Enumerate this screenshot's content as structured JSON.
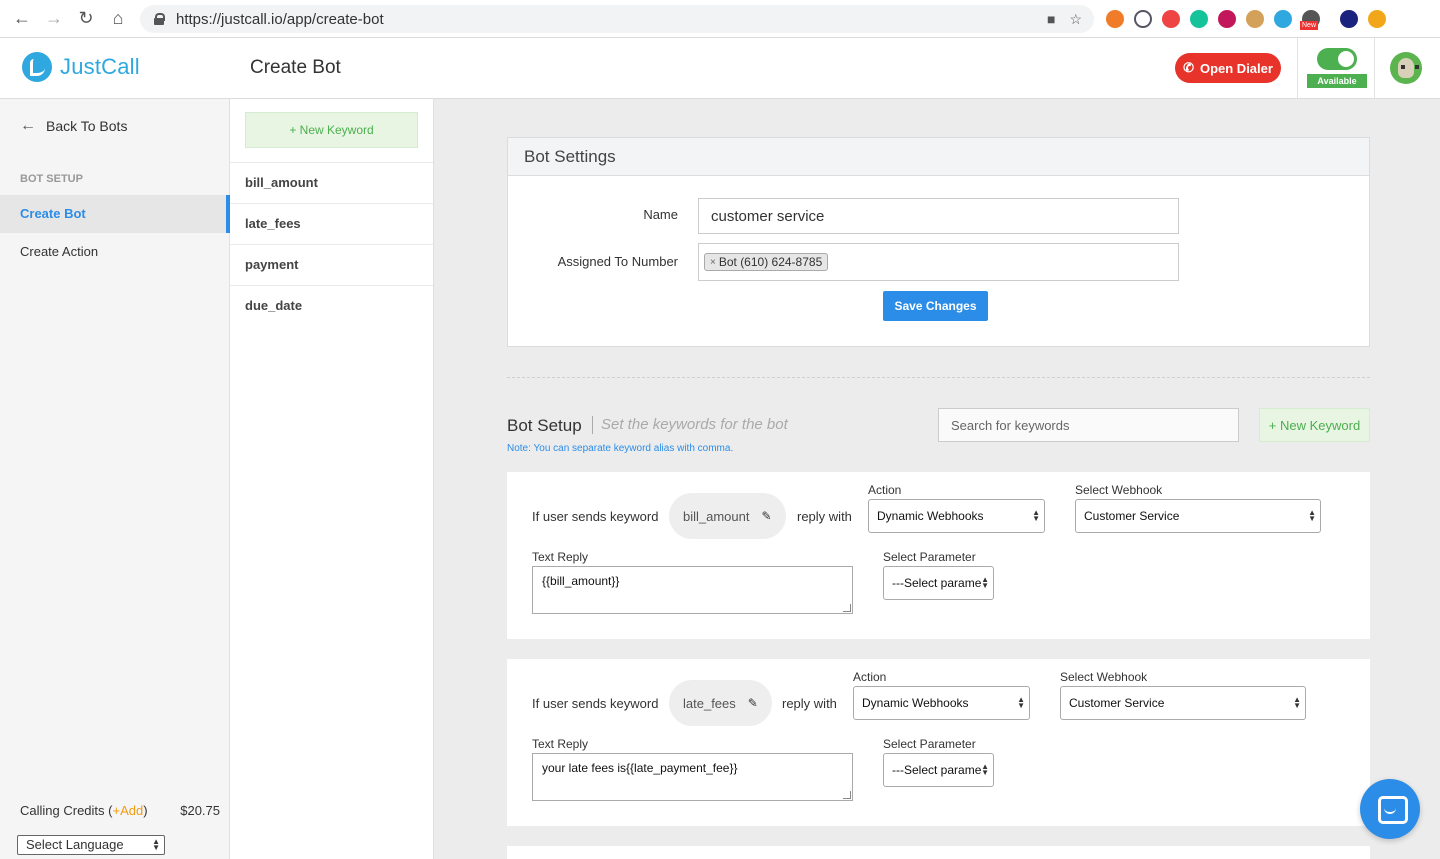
{
  "browser": {
    "url": "https://justcall.io/app/create-bot",
    "ext_badge": "New"
  },
  "header": {
    "logo_text": "JustCall",
    "page_title": "Create Bot",
    "open_dialer_label": "Open Dialer",
    "status_label": "Available"
  },
  "sidebar": {
    "back_label": "Back To Bots",
    "section_label": "BOT SETUP",
    "items": [
      {
        "label": "Create Bot",
        "active": true
      },
      {
        "label": "Create Action",
        "active": false
      }
    ],
    "credits_label": "Calling Credits (",
    "credits_add": "+Add",
    "credits_close": ")",
    "credits_value": "$20.75",
    "language_select": "Select Language"
  },
  "keyword_column": {
    "new_keyword_label": "+ New Keyword",
    "keywords": [
      "bill_amount",
      "late_fees",
      "payment",
      "due_date"
    ]
  },
  "bot_settings": {
    "title": "Bot Settings",
    "name_label": "Name",
    "name_value": "customer service",
    "assigned_label": "Assigned To Number",
    "assigned_tag": "Bot (610) 624-8785",
    "save_label": "Save Changes"
  },
  "bot_setup": {
    "title": "Bot Setup",
    "subtitle": "Set the keywords for the bot",
    "note": "Note: You can separate keyword alias with comma.",
    "search_placeholder": "Search for keywords",
    "new_keyword_label": "+ New Keyword"
  },
  "keyword_cards": [
    {
      "if_label": "If user sends keyword",
      "keyword": "bill_amount",
      "reply_label": "reply with",
      "action_label": "Action",
      "action_value": "Dynamic Webhooks",
      "webhook_label": "Select Webhook",
      "webhook_value": "Customer Service",
      "text_reply_label": "Text Reply",
      "text_reply_value": "{{bill_amount}}",
      "param_label": "Select Parameter",
      "param_value": "---Select parame"
    },
    {
      "if_label": "If user sends keyword",
      "keyword": "late_fees",
      "reply_label": "reply with",
      "action_label": "Action",
      "action_value": "Dynamic Webhooks",
      "webhook_label": "Select Webhook",
      "webhook_value": "Customer Service",
      "text_reply_label": "Text Reply",
      "text_reply_value": "your late fees is{{late_payment_fee}}",
      "param_label": "Select Parameter",
      "param_value": "---Select parame"
    }
  ],
  "colors": {
    "accent": "#2c8de8",
    "danger": "#e8332b",
    "success": "#4caf50",
    "brand": "#2fa8e0"
  }
}
